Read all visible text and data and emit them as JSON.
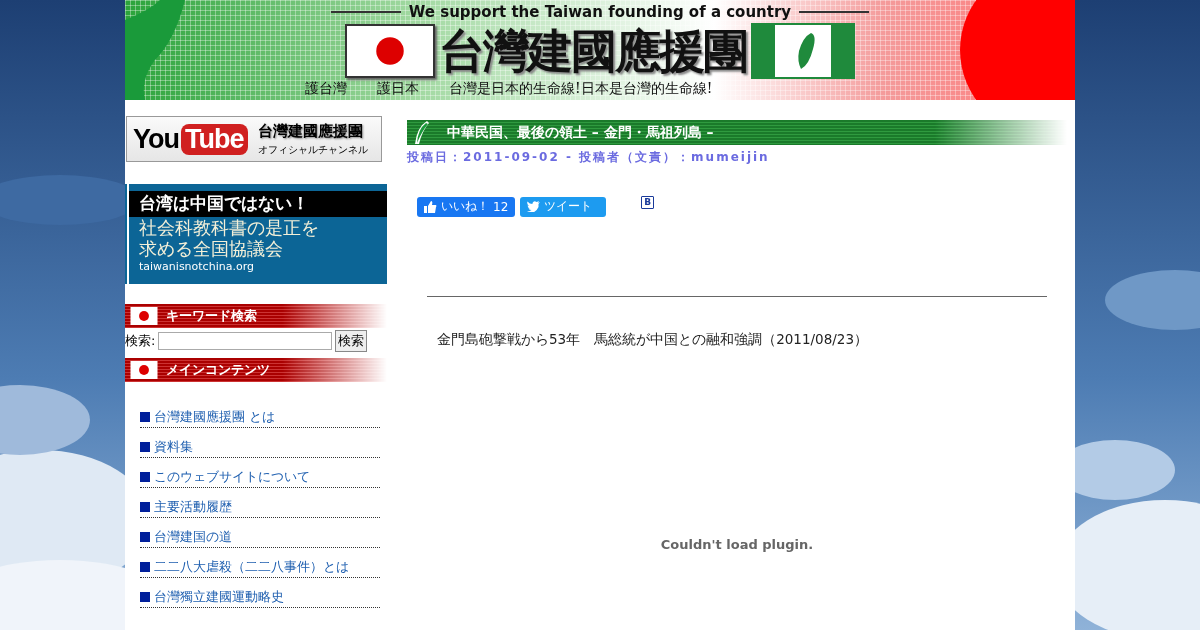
{
  "header": {
    "tagline": "We support the Taiwan founding of a country",
    "title": "台灣建國應援團",
    "mottos": [
      "護台灣",
      "護日本",
      "台灣是日本的生命線!日本是台灣的生命線!"
    ]
  },
  "sidebar": {
    "youtube_banner": {
      "logo_left": "You",
      "logo_right": "Tube",
      "title": "台灣建國應援團",
      "subtitle": "オフィシャルチャンネル"
    },
    "campaign_banner": {
      "headline": "台湾は中国ではない！",
      "lines": [
        "社会科教科書の是正を",
        "求める全国協議会"
      ],
      "url": "taiwanisnotchina.org"
    },
    "search": {
      "heading": "キーワード検索",
      "label": "検索:",
      "button": "検索"
    },
    "menu": {
      "heading": "メインコンテンツ",
      "items": [
        "台灣建國應援團 とは",
        "資料集",
        "このウェブサイトについて",
        "主要活動履歴",
        "台灣建国の道",
        "二二八大虐殺（二二八事件）とは",
        "台灣獨立建國運動略史"
      ]
    }
  },
  "article": {
    "title": "中華民国、最後の領土 – 金門・馬祖列島 –",
    "meta": "投稿日：2011-09-02 - 投稿者（文責）：mumeijin",
    "social": {
      "like_label": "いいね！",
      "like_count": "12",
      "tweet_label": "ツイート",
      "hatena_label": "B"
    },
    "body": "金門島砲撃戦から53年　馬総統が中国との融和強調（2011/08/23）",
    "plugin_message": "Couldn't load plugin."
  }
}
